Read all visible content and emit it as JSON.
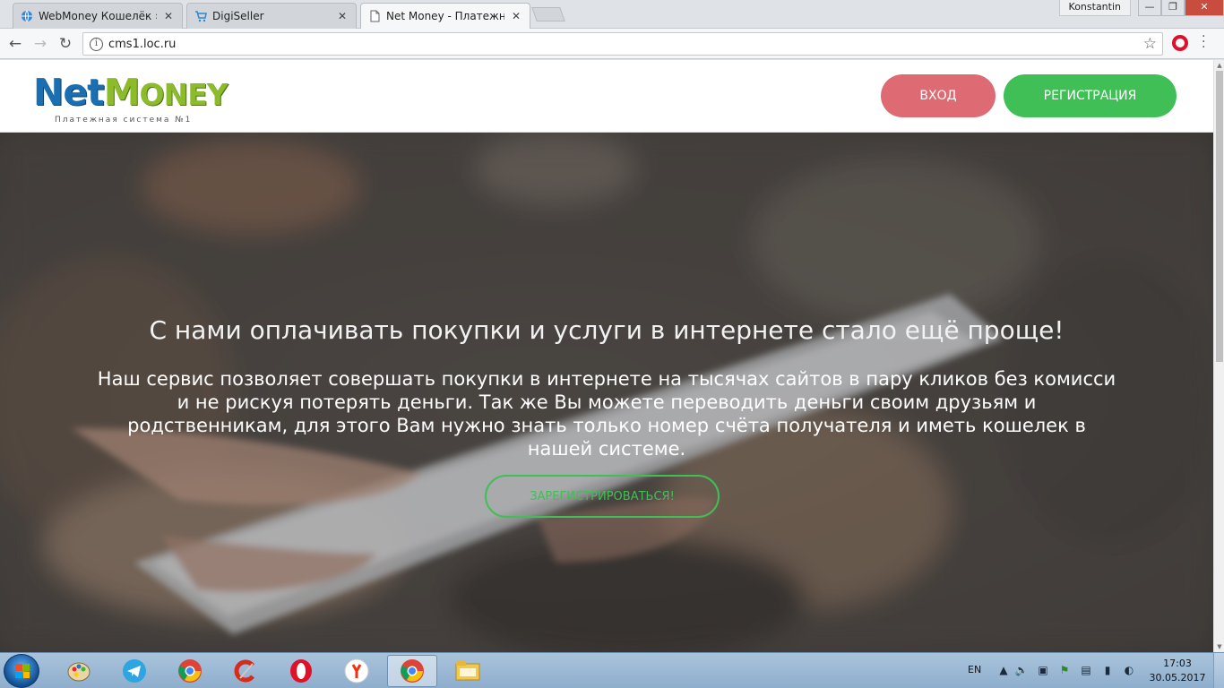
{
  "browser": {
    "tabs": [
      {
        "title": "WebMoney Кошелёк »",
        "active": false
      },
      {
        "title": "DigiSeller",
        "active": false
      },
      {
        "title": "Net Money - Платежная",
        "active": true
      }
    ],
    "user": "Konstantin",
    "window_controls": {
      "minimize": "—",
      "maximize": "❐",
      "close": "✕"
    },
    "url": "cms1.loc.ru"
  },
  "site": {
    "logo": {
      "net": "Net",
      "money_initial": "M",
      "money_rest": "ONEY",
      "tagline": "Платежная система №1"
    },
    "nav": {
      "login": "ВХОД",
      "register": "РЕГИСТРАЦИЯ"
    },
    "hero": {
      "title": "С нами оплачивать покупки и услуги в интернете стало ещё проще!",
      "text": "Наш сервис позволяет совершать покупки в интернете на тысячах сайтов в пару кликов без комисси и не рискуя потерять деньги. Так же Вы можете переводить деньги своим друзьям и родственникам, для этого Вам нужно знать только номер счёта получателя и иметь кошелек в нашей системе.",
      "cta": "ЗАРЕГИСТРИРОВАТЬСЯ!"
    }
  },
  "colors": {
    "login": "#de6b73",
    "register": "#3fbf55",
    "logo_blue": "#1a6fb3",
    "logo_green": "#8cbc2b"
  },
  "taskbar": {
    "items": [
      "paint-icon",
      "telegram-icon",
      "chrome-icon",
      "ccleaner-icon",
      "opera-icon",
      "yandex-browser-icon",
      "chrome-icon",
      "explorer-icon"
    ],
    "lang": "EN",
    "time": "17:03",
    "date": "30.05.2017"
  }
}
